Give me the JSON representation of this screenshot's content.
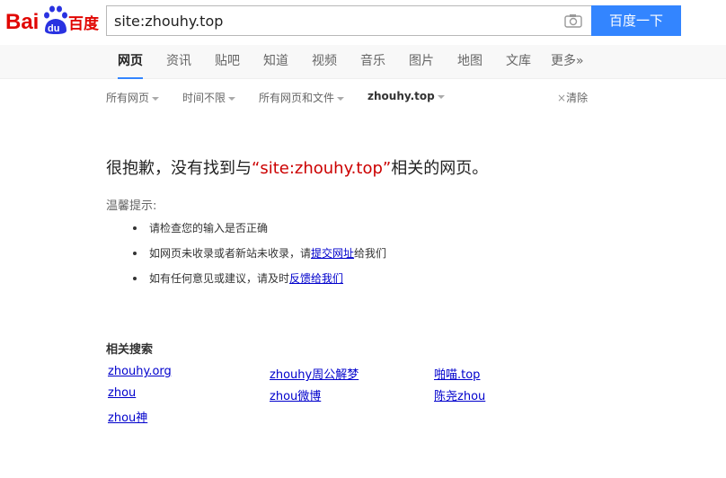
{
  "logo": {
    "text_bai": "Bai",
    "text_du": "du",
    "text_cn": "百度"
  },
  "search": {
    "value": "site:zhouhy.top",
    "button_label": "百度一下"
  },
  "tabs": [
    {
      "label": "网页"
    },
    {
      "label": "资讯"
    },
    {
      "label": "贴吧"
    },
    {
      "label": "知道"
    },
    {
      "label": "视频"
    },
    {
      "label": "音乐"
    },
    {
      "label": "图片"
    },
    {
      "label": "地图"
    },
    {
      "label": "文库"
    },
    {
      "label": "更多»"
    }
  ],
  "filters": {
    "all_pages": "所有网页",
    "time": "时间不限",
    "file_type": "所有网页和文件",
    "site": "zhouhy.top",
    "clear": "清除"
  },
  "message": {
    "prefix": "很抱歉，没有找到与",
    "open_quote": "“",
    "query": "site:zhouhy.top",
    "close_quote": "”",
    "suffix": "相关的网页。"
  },
  "tips": {
    "title": "温馨提示:",
    "item1": "请检查您的输入是否正确",
    "item2_prefix": "如网页未收录或者新站未收录，请",
    "item2_link": "提交网址",
    "item2_suffix": "给我们",
    "item3_prefix": "如有任何意见或建议，请及时",
    "item3_link": "反馈给我们"
  },
  "related": {
    "title": "相关搜索",
    "items": [
      "zhouhy.org",
      "zhouhy周公解梦",
      "啪喵.top",
      "zhou",
      "zhou微博",
      "陈尧zhou",
      "zhou神"
    ]
  },
  "colors": {
    "accent": "#3385ff",
    "query_red": "#c00",
    "link": "#00c"
  }
}
